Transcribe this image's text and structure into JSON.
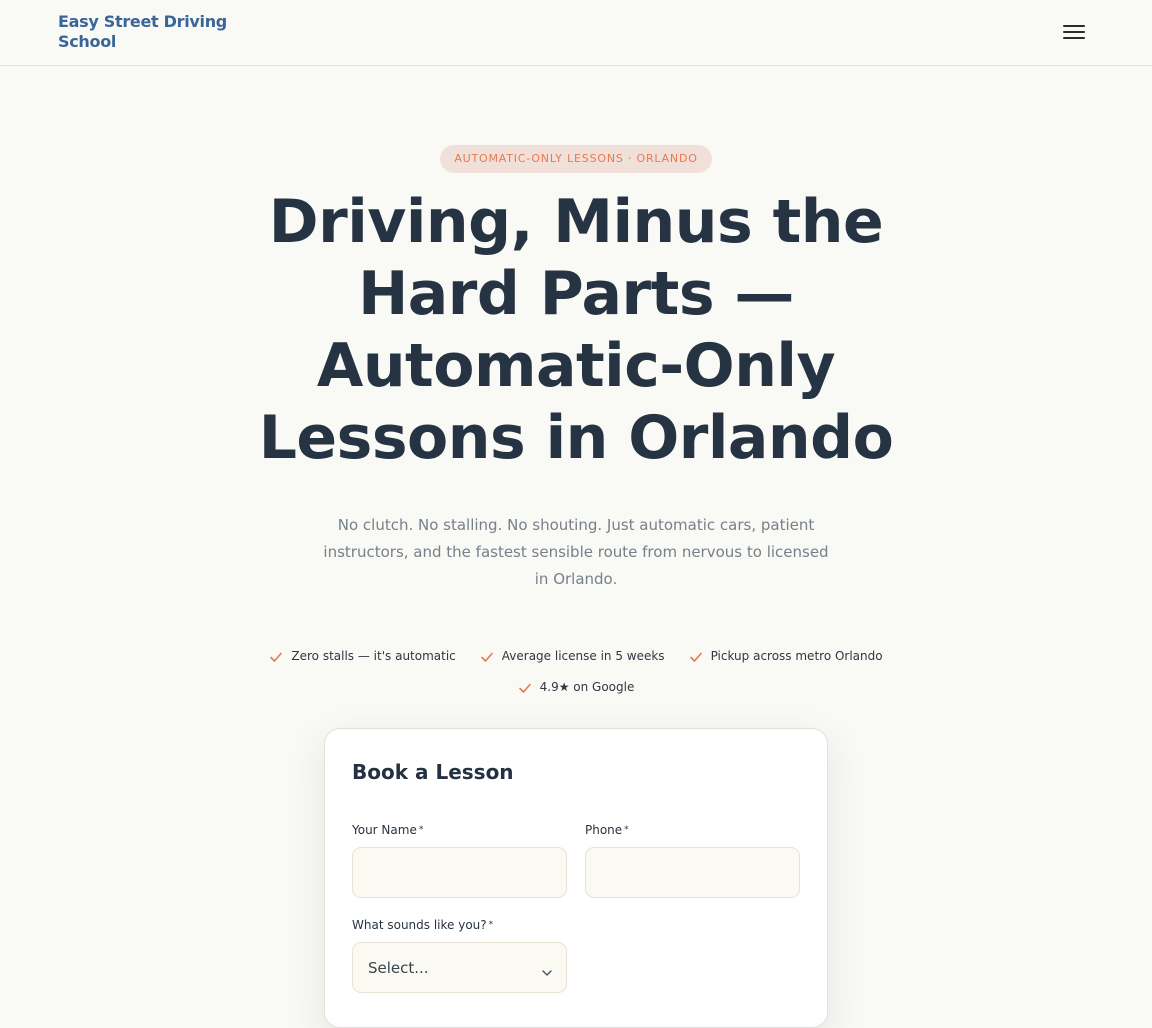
{
  "header": {
    "logo_text": "Easy Street Driving School",
    "menu_icon": "hamburger-menu-icon"
  },
  "hero": {
    "eyebrow": "AUTOMATIC-ONLY LESSONS · ORLANDO",
    "title": "Driving, Minus the Hard Parts — Automatic-Only Lessons in Orlando",
    "subtitle": "No clutch. No stalling. No shouting. Just automatic cars, patient instructors, and the fastest sensible route from nervous to licensed in Orlando.",
    "benefits": [
      "Zero stalls — it's automatic",
      "Average license in 5 weeks",
      "Pickup across metro Orlando",
      "4.9★ on Google"
    ],
    "check_icon": "check-icon",
    "accent_color": "#e67a4e"
  },
  "booking_form": {
    "title": "Book a Lesson",
    "name_label": "Your Name",
    "name_value": "",
    "phone_label": "Phone",
    "phone_value": "",
    "situation_label": "What sounds like you?",
    "situation_selected": "Select...",
    "required_marker": "*"
  },
  "colors": {
    "brand": "#3a6599",
    "heading": "#263342",
    "background": "#f9f9f6",
    "eyebrow_bg": "#f1e0d9"
  }
}
